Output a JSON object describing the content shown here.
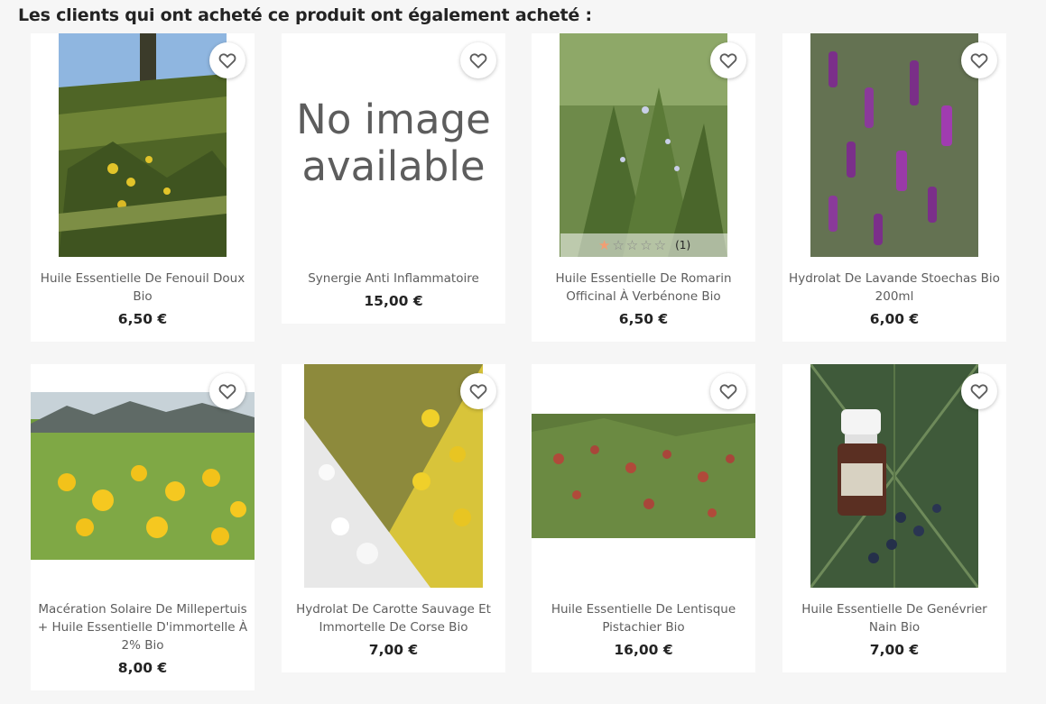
{
  "section_title": "Les clients qui ont acheté ce produit ont également acheté :",
  "no_image_text": [
    "No image",
    "available"
  ],
  "wishlist_icon": "heart-outline-icon",
  "colors": {
    "star_on": "#f39d72",
    "star_off": "#8a8a8a",
    "background": "#f6f6f6"
  },
  "products": [
    {
      "name": "Huile Essentielle De Fenouil Doux Bio",
      "price": "6,50 €"
    },
    {
      "name": "Synergie Anti Inflammatoire",
      "price": "15,00 €"
    },
    {
      "name": "Huile Essentielle De Romarin Officinal À Verbénone Bio",
      "price": "6,50 €",
      "rating": {
        "stars": 1,
        "max": 5,
        "count_label": "(1)"
      }
    },
    {
      "name": "Hydrolat De Lavande Stoechas Bio 200ml",
      "price": "6,00 €"
    },
    {
      "name": "Macération Solaire De Millepertuis + Huile Essentielle D'immortelle À 2% Bio",
      "price": "8,00 €"
    },
    {
      "name": "Hydrolat De Carotte Sauvage Et Immortelle De Corse Bio",
      "price": "7,00 €"
    },
    {
      "name": "Huile Essentielle De Lentisque Pistachier Bio",
      "price": "16,00 €"
    },
    {
      "name": "Huile Essentielle De Genévrier Nain Bio",
      "price": "7,00 €"
    }
  ]
}
